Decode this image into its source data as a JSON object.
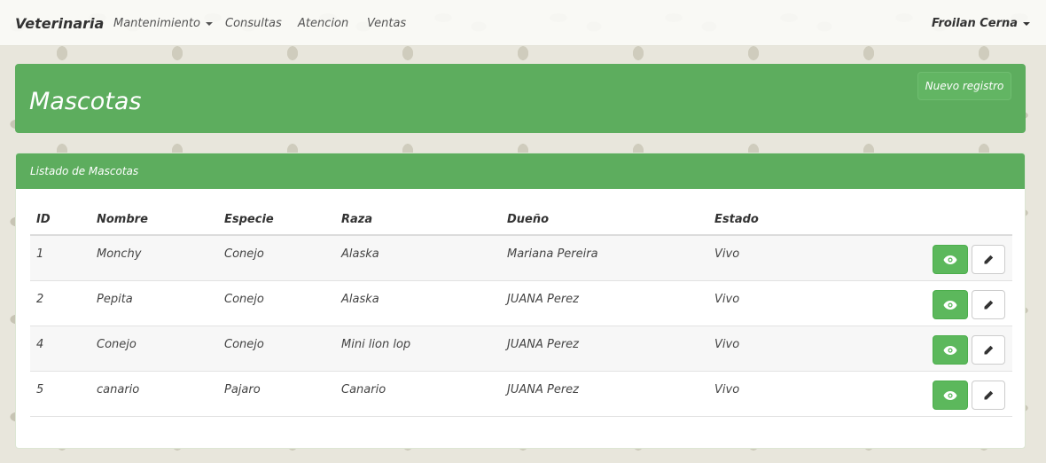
{
  "navbar": {
    "brand": "Veterinaria",
    "items": [
      {
        "label": "Mantenimiento",
        "dropdown": true
      },
      {
        "label": "Consultas",
        "dropdown": false
      },
      {
        "label": "Atencion",
        "dropdown": false
      },
      {
        "label": "Ventas",
        "dropdown": false
      }
    ],
    "user": "Froilan Cerna"
  },
  "header": {
    "title": "Mascotas",
    "new_button": "Nuevo registro"
  },
  "panel": {
    "title": "Listado de Mascotas",
    "columns": [
      "ID",
      "Nombre",
      "Especie",
      "Raza",
      "Dueño",
      "Estado"
    ],
    "rows": [
      {
        "id": "1",
        "nombre": "Monchy",
        "especie": "Conejo",
        "raza": "Alaska",
        "dueno": "Mariana Pereira",
        "estado": "Vivo"
      },
      {
        "id": "2",
        "nombre": "Pepita",
        "especie": "Conejo",
        "raza": "Alaska",
        "dueno": "JUANA Perez",
        "estado": "Vivo"
      },
      {
        "id": "4",
        "nombre": "Conejo",
        "especie": "Conejo",
        "raza": "Mini lion lop",
        "dueno": "JUANA Perez",
        "estado": "Vivo"
      },
      {
        "id": "5",
        "nombre": "canario",
        "especie": "Pajaro",
        "raza": "Canario",
        "dueno": "JUANA Perez",
        "estado": "Vivo"
      }
    ],
    "row_actions": {
      "view_icon": "eye-icon",
      "edit_icon": "pencil-icon"
    }
  },
  "colors": {
    "accent": "#5dad5e",
    "view_button": "#5cb85c"
  }
}
